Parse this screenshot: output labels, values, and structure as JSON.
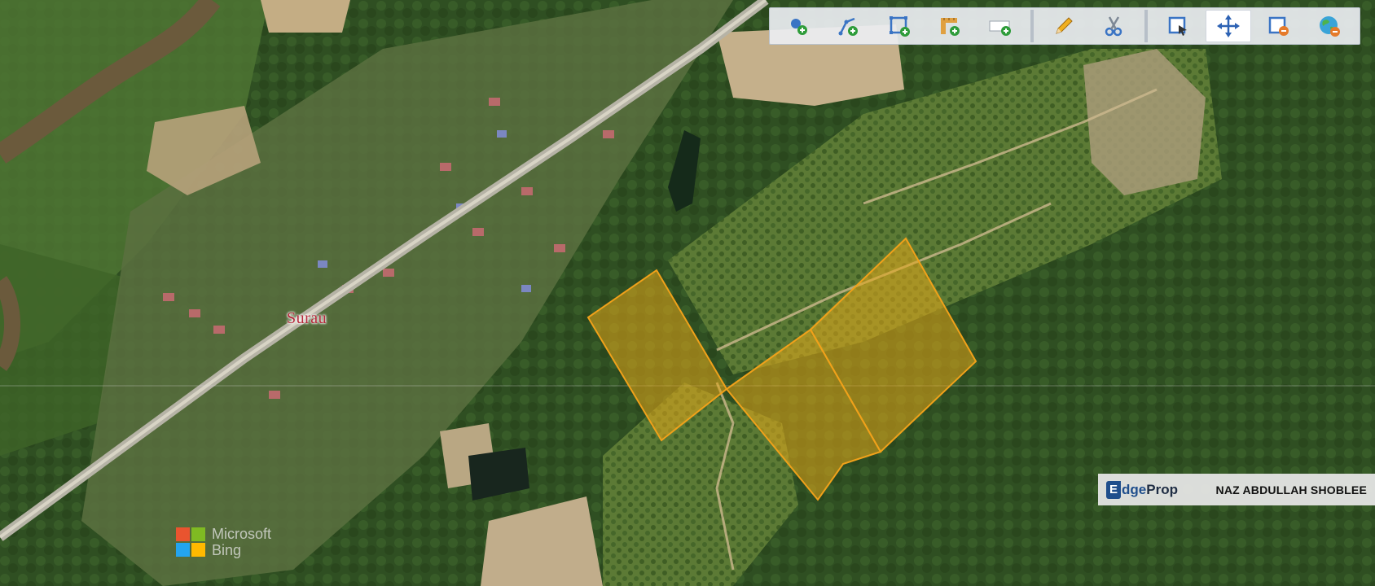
{
  "map": {
    "place_label": "Surau",
    "plot_fill": "#e6a817",
    "plot_stroke": "#f0a11a"
  },
  "toolbar": {
    "tools": [
      {
        "name": "add-point-tool-button",
        "icon": "point-plus-icon"
      },
      {
        "name": "add-line-tool-button",
        "icon": "line-plus-icon"
      },
      {
        "name": "add-polygon-tool-button",
        "icon": "polygon-plus-icon"
      },
      {
        "name": "add-measure-tool-button",
        "icon": "measure-plus-icon"
      },
      {
        "name": "add-label-tool-button",
        "icon": "label-plus-icon"
      },
      {
        "name": "edit-tool-button",
        "icon": "pencil-icon"
      },
      {
        "name": "cut-tool-button",
        "icon": "scissors-icon"
      },
      {
        "name": "zoom-select-tool-button",
        "icon": "select-icon"
      },
      {
        "name": "pan-tool-button",
        "icon": "move-icon",
        "active": true
      },
      {
        "name": "remove-tool-button",
        "icon": "remove-icon"
      },
      {
        "name": "globe-tool-button",
        "icon": "globe-icon"
      }
    ]
  },
  "branding": {
    "logo_e": "E",
    "logo_edge": "dge",
    "logo_prop": "Prop",
    "agent_name": "NAZ ABDULLAH SHOBLEE"
  },
  "attribution": {
    "line1": "Microsoft",
    "line2": "Bing"
  },
  "colors": {
    "accent": "#f0a11a",
    "brand": "#1f4e8c",
    "label_red": "#b5283a"
  }
}
